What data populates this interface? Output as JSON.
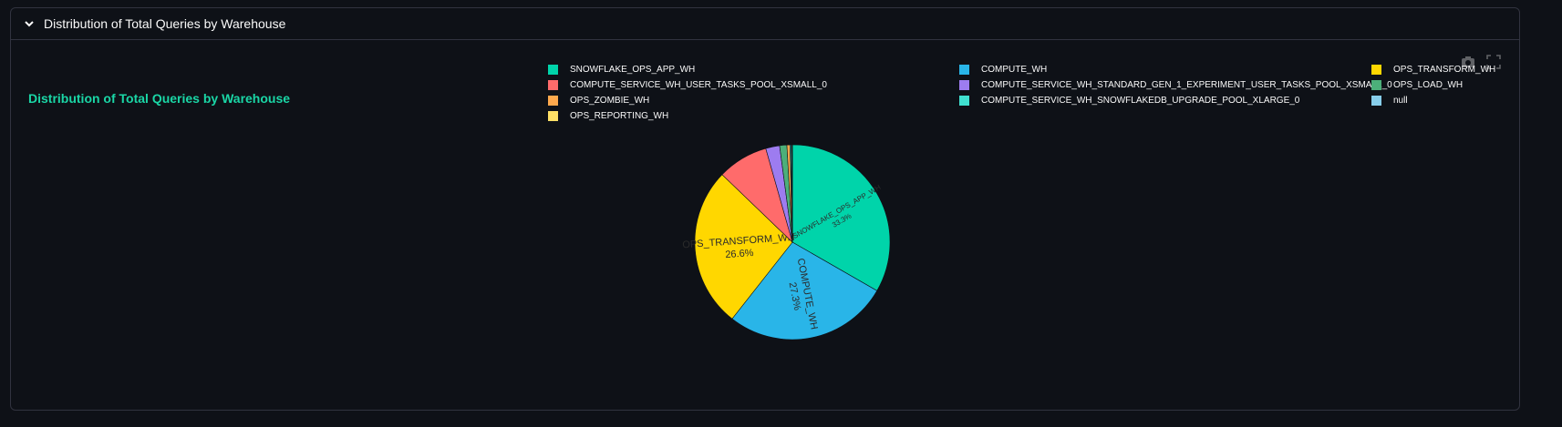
{
  "expander": {
    "title": "Distribution of Total Queries by Warehouse"
  },
  "chart_data": {
    "type": "pie",
    "title": "Distribution of Total Queries by Warehouse",
    "legend_placement": "top",
    "slices": [
      {
        "label": "SNOWFLAKE_OPS_APP_WH",
        "value": 33.3,
        "color": "#00d4aa",
        "text": "33.3%"
      },
      {
        "label": "COMPUTE_WH",
        "value": 27.3,
        "color": "#29b5e8",
        "text": "27.3%"
      },
      {
        "label": "OPS_TRANSFORM_WH",
        "value": 26.6,
        "color": "#ffd700",
        "text": "26.6%"
      },
      {
        "label": "COMPUTE_SERVICE_WH_USER_TASKS_POOL_XSMALL_0",
        "value": 8.4,
        "color": "#ff6b6b",
        "text": ""
      },
      {
        "label": "COMPUTE_SERVICE_WH_STANDARD_GEN_1_EXPERIMENT_USER_TASKS_POOL_XSMALL_0",
        "value": 2.3,
        "color": "#9d7cf0",
        "text": ""
      },
      {
        "label": "OPS_LOAD_WH",
        "value": 1.2,
        "color": "#4caf7a",
        "text": ""
      },
      {
        "label": "OPS_ZOMBIE_WH",
        "value": 0.5,
        "color": "#ffa94d",
        "text": ""
      },
      {
        "label": "COMPUTE_SERVICE_WH_SNOWFLAKEDB_UPGRADE_POOL_XLARGE_0",
        "value": 0.2,
        "color": "#40e0d0",
        "text": ""
      },
      {
        "label": "null",
        "value": 0.1,
        "color": "#87ceeb",
        "text": ""
      },
      {
        "label": "OPS_REPORTING_WH",
        "value": 0.1,
        "color": "#ffe066",
        "text": ""
      }
    ],
    "legend": [
      "SNOWFLAKE_OPS_APP_WH",
      "COMPUTE_SERVICE_WH_USER_TASKS_POOL_XSMALL_0",
      "OPS_ZOMBIE_WH",
      "OPS_REPORTING_WH",
      "COMPUTE_WH",
      "COMPUTE_SERVICE_WH_STANDARD_GEN_1_EXPERIMENT_USER_TASKS_POOL_XSMALL_0",
      "COMPUTE_SERVICE_WH_SNOWFLAKEDB_UPGRADE_POOL_XLARGE_0",
      "OPS_TRANSFORM_WH",
      "OPS_LOAD_WH",
      "null"
    ]
  }
}
